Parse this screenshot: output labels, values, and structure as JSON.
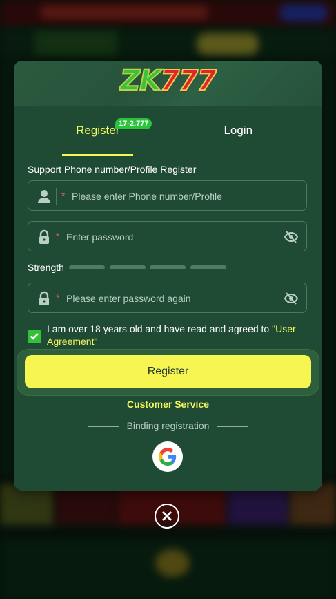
{
  "logo": {
    "part1": "ZK",
    "part2": "777"
  },
  "tabs": {
    "register": "Register",
    "login": "Login",
    "badge": "17-2,777"
  },
  "form": {
    "support_label": "Support Phone number/Profile Register",
    "phone": {
      "required_mark": "*",
      "placeholder": "Please enter Phone number/Profile"
    },
    "password": {
      "required_mark": "*",
      "placeholder": "Enter password"
    },
    "strength_label": "Strength",
    "confirm": {
      "required_mark": "*",
      "placeholder": "Please enter password again"
    },
    "agreement_text": "I am over 18 years old and have read and agreed to ",
    "agreement_link": "\"User Agreement\"",
    "agreement_checked": true,
    "submit_label": "Register"
  },
  "customer_service": "Customer Service",
  "binding_label": "Binding registration",
  "social": [
    "google-icon"
  ],
  "colors": {
    "modal_bg": "#1f4a33",
    "accent_yellow": "#f6f551",
    "checkbox_green": "#32c238",
    "badge_green": "#28c43a"
  }
}
